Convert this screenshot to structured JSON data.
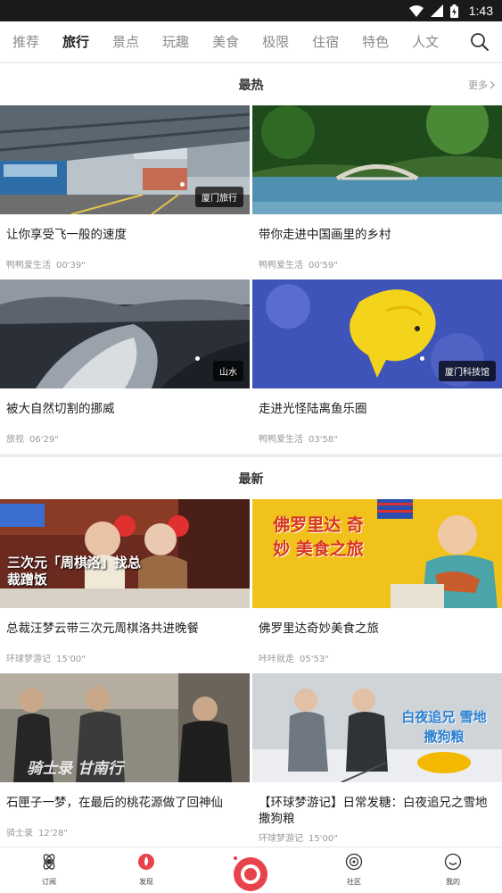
{
  "status_bar": {
    "time": "1:43"
  },
  "top_tabs": [
    "推荐",
    "旅行",
    "景点",
    "玩趣",
    "美食",
    "极限",
    "住宿",
    "特色",
    "人文"
  ],
  "active_tab": "旅行",
  "hot": {
    "title": "最热",
    "more": "更多",
    "cards": [
      {
        "title": "让你享受飞一般的速度",
        "author": "鸭鸭爱生活",
        "duration": "00'39\"",
        "tag": "厦门旅行"
      },
      {
        "title": "带你走进中国画里的乡村",
        "author": "鸭鸭爱生活",
        "duration": "00'59\"",
        "tag": ""
      },
      {
        "title": "被大自然切割的挪威",
        "author": "旅视",
        "duration": "06'29\"",
        "tag": "山水"
      },
      {
        "title": "走进光怪陆离鱼乐圈",
        "author": "鸭鸭爱生活",
        "duration": "03'58\"",
        "tag": "厦门科技馆"
      }
    ]
  },
  "latest": {
    "title": "最新",
    "cards": [
      {
        "title": "总裁汪梦云带三次元周棋洛共进晚餐",
        "author": "环球梦游记",
        "duration": "15'00\"",
        "overlay": "三次元「周棋洛」找总裁蹭饭"
      },
      {
        "title": "佛罗里达奇妙美食之旅",
        "author": "咔咔就走",
        "duration": "05'53\"",
        "overlay": "佛罗里达 奇妙 美食之旅"
      },
      {
        "title": "石匣子一梦，在最后的桃花源做了回神仙",
        "author": "骑士录",
        "duration": "12'28\"",
        "overlay": "骑士录 甘南行"
      },
      {
        "title": "【环球梦游记】日常发糖：白夜追兄之雪地撒狗粮",
        "author": "环球梦游记",
        "duration": "15'00\"",
        "overlay": "白夜追兄 雪地撒狗粮"
      }
    ]
  },
  "bottom_nav": [
    {
      "label": "订阅",
      "icon": "subscribe-icon"
    },
    {
      "label": "发现",
      "icon": "discover-icon"
    },
    {
      "label": "",
      "icon": "record-icon"
    },
    {
      "label": "社区",
      "icon": "community-icon"
    },
    {
      "label": "我的",
      "icon": "profile-icon"
    }
  ],
  "colors": {
    "accent": "#e8424a",
    "active_tab": "#222222",
    "inactive_tab": "#8a8a8a"
  }
}
